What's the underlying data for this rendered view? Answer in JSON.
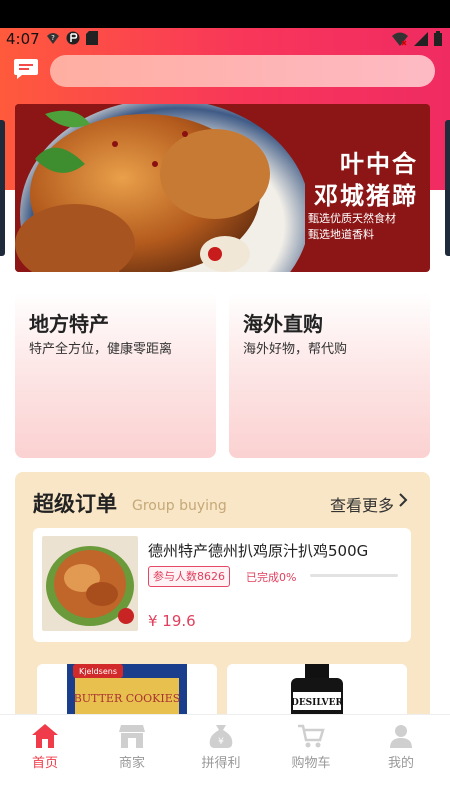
{
  "status": {
    "time": "4:07"
  },
  "banner": {
    "title_line1": "叶中合",
    "title_line2": "邓城猪蹄",
    "sub_line1": "甄选优质天然食材",
    "sub_line2": "甄选地道香料"
  },
  "categories": [
    {
      "title": "地方特产",
      "desc": "特产全方位，健康零距离"
    },
    {
      "title": "海外直购",
      "desc": "海外好物，帮代购"
    }
  ],
  "group": {
    "title": "超级订单",
    "subtitle": "Group buying",
    "more": "查看更多",
    "item": {
      "name": "德州特产德州扒鸡原汁扒鸡500G",
      "participants": "参与人数8626",
      "completed": "已完成0%",
      "progress": 0,
      "price": "¥ 19.6"
    },
    "products": [
      {
        "brand": "Kjeldsens",
        "name": "BUTTER COOKIES"
      },
      {
        "brand": "DESILVER"
      }
    ]
  },
  "nav": [
    {
      "label": "首页",
      "icon": "home-icon",
      "active": true
    },
    {
      "label": "商家",
      "icon": "store-icon",
      "active": false
    },
    {
      "label": "拼得利",
      "icon": "money-bag-icon",
      "active": false
    },
    {
      "label": "购物车",
      "icon": "cart-icon",
      "active": false
    },
    {
      "label": "我的",
      "icon": "user-icon",
      "active": false
    }
  ],
  "colors": {
    "accent": "#f03c4a",
    "header_from": "#ff5a3c",
    "header_to": "#ef2b62",
    "group_bg": "#f8e6c6"
  }
}
